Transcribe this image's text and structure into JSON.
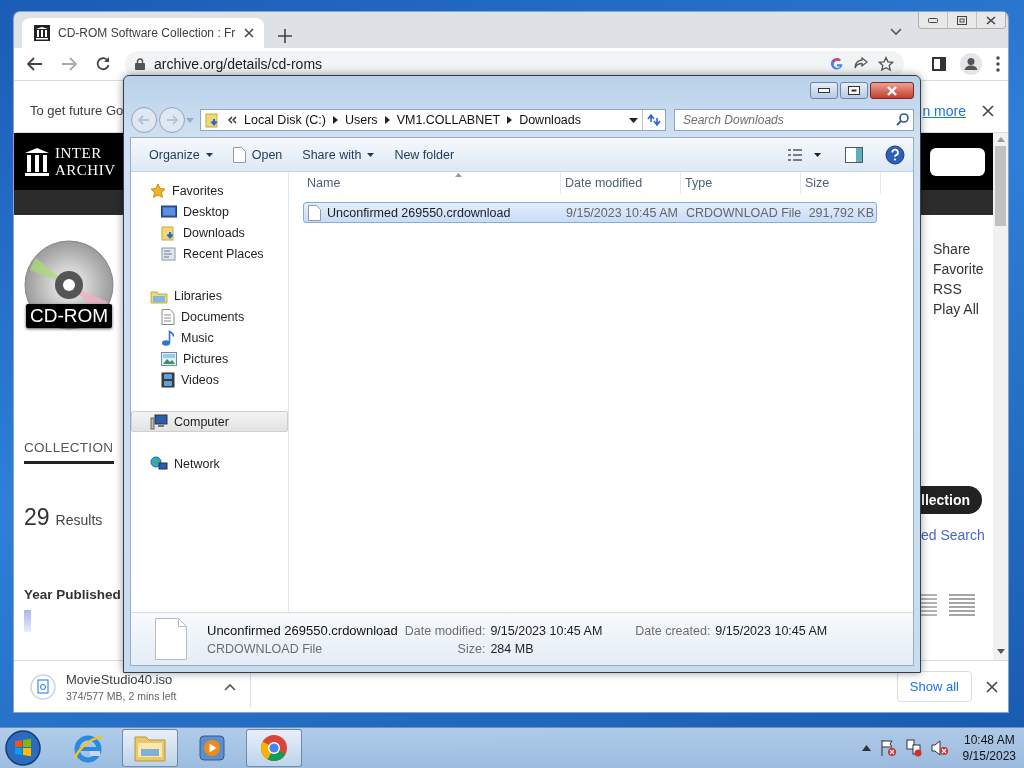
{
  "browser": {
    "tabs": [
      {
        "title": "CD-ROM Software Collection : Fr",
        "selected": true
      }
    ],
    "address": "archive.org/details/cd-roms",
    "infobar": {
      "text": "To get future Go",
      "link": "n more"
    },
    "site": {
      "logo_lines": [
        "INTER",
        "ARCHIV"
      ],
      "collection_badge": "CD-ROM",
      "tabs": [
        {
          "label": "COLLECTION",
          "selected": true
        }
      ],
      "results": {
        "count": "29",
        "label": "Results"
      },
      "facet_title": "Year Published",
      "actions": [
        "Share",
        "Favorite",
        "RSS",
        "Play All"
      ],
      "collection_button": "llection",
      "search_link": "ed Search"
    },
    "download": {
      "file": "MovieStudio40.iso",
      "status": "374/577 MB, 2 mins left",
      "show_all": "Show all"
    }
  },
  "explorer": {
    "path": [
      "Local Disk (C:)",
      "Users",
      "VM1.COLLABNET",
      "Downloads"
    ],
    "search_placeholder": "Search Downloads",
    "commands": [
      {
        "label": "Organize",
        "kind": "menu"
      },
      {
        "label": "Open",
        "kind": "file"
      },
      {
        "label": "Share with",
        "kind": "menu"
      },
      {
        "label": "New folder",
        "kind": "plain"
      }
    ],
    "nav": [
      {
        "label": "Favorites",
        "kind": "favorites",
        "selected": false,
        "children": [
          {
            "label": "Desktop",
            "kind": "desktop",
            "selected": false
          },
          {
            "label": "Downloads",
            "kind": "downloads",
            "selected": false
          },
          {
            "label": "Recent Places",
            "kind": "recent",
            "selected": false
          }
        ]
      },
      {
        "label": "Libraries",
        "kind": "libraries",
        "selected": false,
        "children": [
          {
            "label": "Documents",
            "kind": "documents",
            "selected": false
          },
          {
            "label": "Music",
            "kind": "music",
            "selected": false
          },
          {
            "label": "Pictures",
            "kind": "pictures",
            "selected": false
          },
          {
            "label": "Videos",
            "kind": "videos",
            "selected": false
          }
        ]
      },
      {
        "label": "Computer",
        "kind": "computer",
        "selected": true
      },
      {
        "label": "Network",
        "kind": "network",
        "selected": false
      }
    ],
    "columns": [
      "Name",
      "Date modified",
      "Type",
      "Size"
    ],
    "files": [
      {
        "name": "Unconfirmed 269550.crdownload",
        "date": "9/15/2023 10:45 AM",
        "type": "CRDOWNLOAD File",
        "size": "291,792 KB",
        "selected": true
      }
    ],
    "details": {
      "name": "Unconfirmed 269550.crdownload",
      "type": "CRDOWNLOAD File",
      "fields": [
        {
          "label": "Date modified:",
          "value": "9/15/2023 10:45 AM"
        },
        {
          "label": "Size:",
          "value": "284 MB"
        },
        {
          "label": "Date created:",
          "value": "9/15/2023 10:45 AM"
        }
      ]
    }
  },
  "taskbar": {
    "apps": [
      {
        "kind": "ie",
        "active": false
      },
      {
        "kind": "explorer",
        "active": true
      },
      {
        "kind": "media",
        "active": false
      },
      {
        "kind": "chrome",
        "active": true
      }
    ],
    "time": "10:48 AM",
    "date": "9/15/2023"
  }
}
